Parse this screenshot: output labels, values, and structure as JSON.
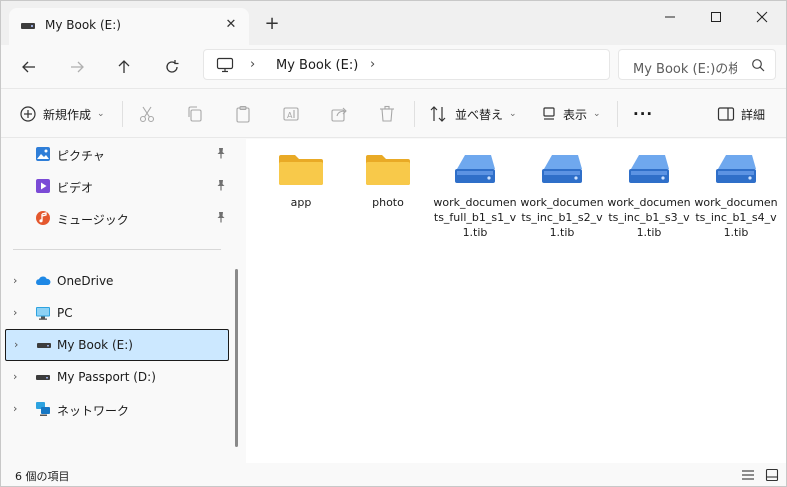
{
  "tab": {
    "title": "My Book (E:)",
    "close_symbol": "✕",
    "new_tab_symbol": "+"
  },
  "navigation": {
    "address_label": "My Book (E:)",
    "separator": "›",
    "search_placeholder": "My Book (E:)の検"
  },
  "toolbar": {
    "new_label": "新規作成",
    "sort_label": "並べ替え",
    "view_label": "表示",
    "more_label": "···",
    "details_label": "詳細"
  },
  "sidebar": {
    "quick_access": [
      {
        "label": "ピクチャ",
        "icon": "pictures-icon"
      },
      {
        "label": "ビデオ",
        "icon": "videos-icon"
      },
      {
        "label": "ミュージック",
        "icon": "music-icon"
      }
    ],
    "tree": [
      {
        "label": "OneDrive",
        "icon": "onedrive-icon"
      },
      {
        "label": "PC",
        "icon": "pc-icon"
      },
      {
        "label": "My Book (E:)",
        "icon": "drive-icon",
        "selected": true
      },
      {
        "label": "My Passport (D:)",
        "icon": "drive-icon"
      },
      {
        "label": "ネットワーク",
        "icon": "network-icon"
      }
    ],
    "expand_symbol": "›"
  },
  "files": [
    {
      "name": "app",
      "type": "folder"
    },
    {
      "name": "photo",
      "type": "folder"
    },
    {
      "name": "work_documents_full_b1_s1_v1.tib",
      "type": "tib"
    },
    {
      "name": "work_documents_inc_b1_s2_v1.tib",
      "type": "tib"
    },
    {
      "name": "work_documents_inc_b1_s3_v1.tib",
      "type": "tib"
    },
    {
      "name": "work_documents_inc_b1_s4_v1.tib",
      "type": "tib"
    }
  ],
  "status": {
    "item_count": "6 個の項目"
  },
  "colors": {
    "accent": "#0067c0",
    "selection": "#cce8ff",
    "folder": "#f8c94a",
    "tib_icon": "#3a7bd5"
  }
}
